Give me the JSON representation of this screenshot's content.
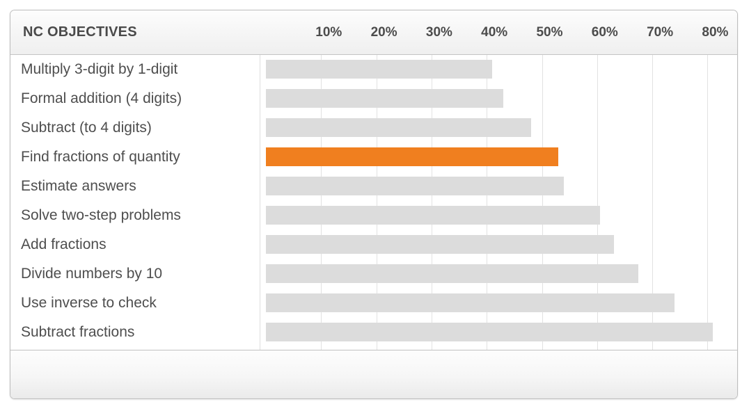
{
  "header": {
    "title": "NC OBJECTIVES"
  },
  "colors": {
    "highlight": "#f07f1f",
    "bar": "#dcdcdc",
    "gridline": "#e2e2e2",
    "text": "#4e4e4e",
    "header_text": "#4a4a4a"
  },
  "footer": {
    "label": ""
  },
  "chart_data": {
    "type": "bar",
    "orientation": "horizontal",
    "title": "NC OBJECTIVES",
    "xlabel": "",
    "ylabel": "",
    "xlim": [
      0,
      85
    ],
    "grid": true,
    "legend": "none",
    "tick_labels": [
      "10%",
      "20%",
      "30%",
      "40%",
      "50%",
      "60%",
      "70%",
      "80%"
    ],
    "tick_values": [
      10,
      20,
      30,
      40,
      50,
      60,
      70,
      80
    ],
    "categories": [
      "Multiply 3-digit by 1-digit",
      "Formal addition (4 digits)",
      "Subtract (to 4 digits)",
      "Find fractions of quantity",
      "Estimate answers",
      "Solve two-step problems",
      "Add fractions",
      "Divide numbers by 10",
      "Use inverse to check",
      "Subtract fractions"
    ],
    "values": [
      41,
      43,
      48,
      53,
      54,
      60.5,
      63,
      67.5,
      74,
      81
    ],
    "highlight_index": 3
  }
}
